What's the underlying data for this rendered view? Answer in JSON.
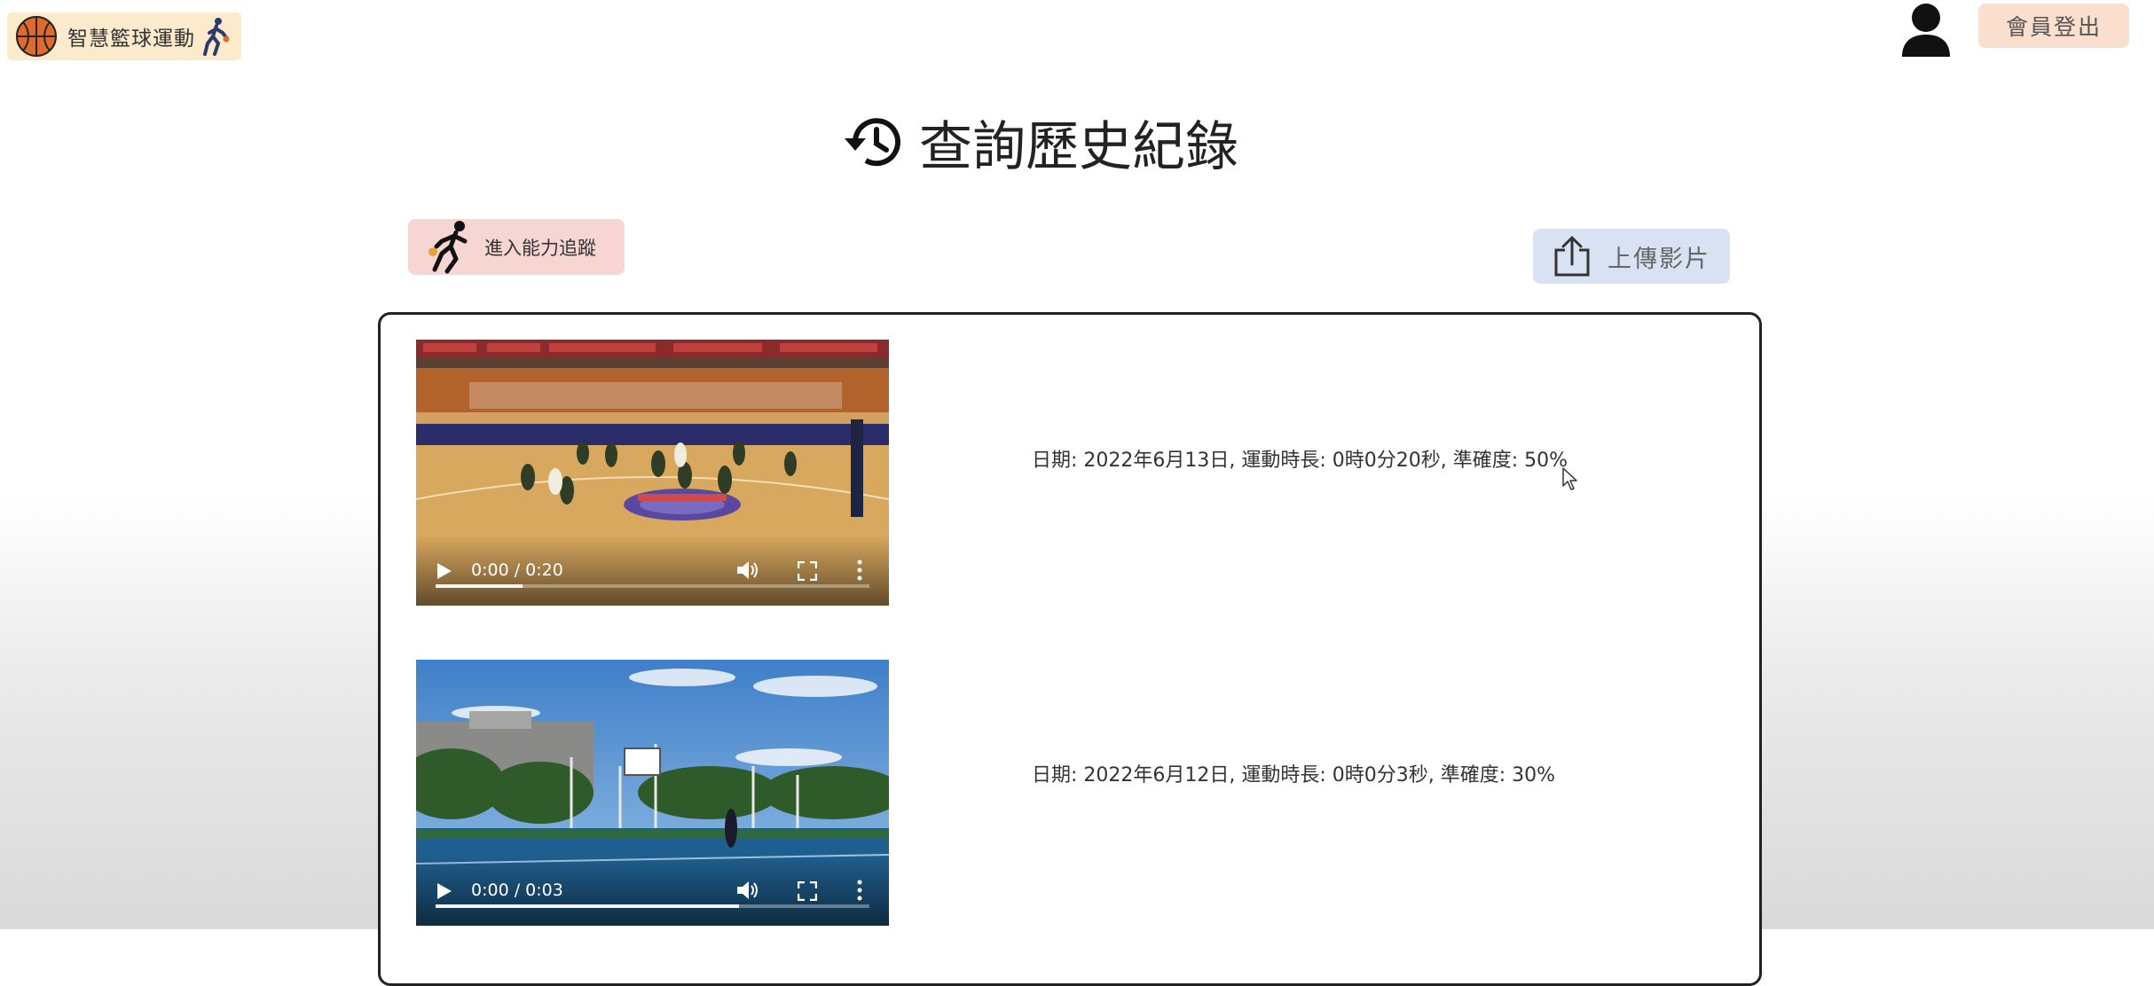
{
  "header": {
    "logo_text": "智慧籃球運動",
    "logout_label": "會員登出"
  },
  "page": {
    "title": "查詢歷史紀錄"
  },
  "actions": {
    "ability_label": "進入能力追蹤",
    "upload_label": "上傳影片"
  },
  "records": [
    {
      "info": "日期: 2022年6月13日, 運動時長: 0時0分20秒, 準確度: 50%",
      "video": {
        "time": "0:00 / 0:20",
        "buffered": 0.2
      }
    },
    {
      "info": "日期: 2022年6月12日, 運動時長: 0時0分3秒, 準確度: 30%",
      "video": {
        "time": "0:00 / 0:03",
        "buffered": 0.7
      }
    }
  ],
  "colors": {
    "logo_bg": "#fbeacb",
    "logout_bg": "#fadfcf",
    "ability_bg": "#f7d5d3",
    "upload_bg": "#d8e2f3",
    "ball": "#e06a2c"
  },
  "icons": [
    "basketball-icon",
    "player-icon",
    "user-icon",
    "history-icon",
    "dribble-icon",
    "upload-icon",
    "play-icon",
    "volume-icon",
    "fullscreen-icon",
    "more-icon",
    "cursor-icon"
  ]
}
